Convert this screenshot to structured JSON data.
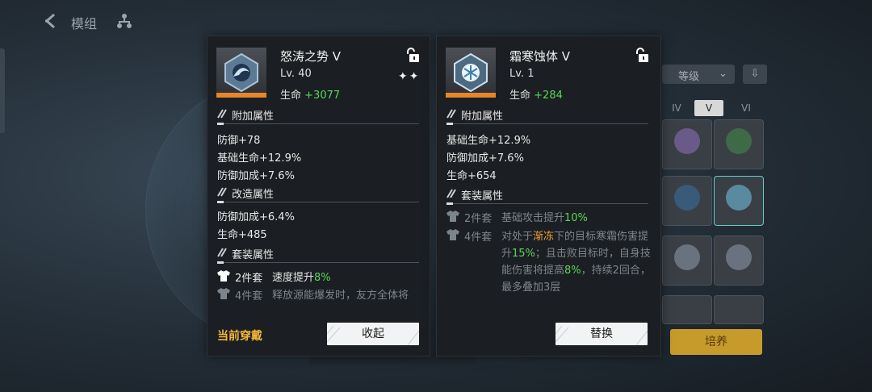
{
  "background": {
    "title": "模组",
    "sort_label": "等级",
    "tabs": [
      "IV",
      "V",
      "VI"
    ],
    "action_label": "培养"
  },
  "left_panel": {
    "name": "怒涛之势 V",
    "level": "Lv. 40",
    "main_stat_label": "生命",
    "main_stat_value": "+3077",
    "stars": "✦✦",
    "sections": {
      "extra_title": "附加属性",
      "extra_stats": [
        "防御+78",
        "基础生命+12.9%",
        "防御加成+7.6%"
      ],
      "mod_title": "改造属性",
      "mod_stats": [
        "防御加成+6.4%",
        "生命+485"
      ],
      "set_title": "套装属性",
      "set2_pieces": "2件套",
      "set2_text": "速度提升",
      "set2_value": "8%",
      "set4_pieces": "4件套",
      "set4_text": "释放源能爆发时，友方全体将"
    },
    "current_wear_label": "当前穿戴",
    "button_label": "收起"
  },
  "right_panel": {
    "name": "霜寒蚀体 V",
    "level": "Lv. 1",
    "main_stat_label": "生命",
    "main_stat_value": "+284",
    "sections": {
      "extra_title": "附加属性",
      "extra_stats": [
        "基础生命+12.9%",
        "防御加成+7.6%",
        "生命+654"
      ],
      "set_title": "套装属性",
      "set2_pieces": "2件套",
      "set2_text": "基础攻击提升",
      "set2_value": "10%",
      "set4_pieces": "4件套",
      "set4_a": "对处于",
      "set4_b": "渐冻",
      "set4_c": "下的目标寒霜伤害提升",
      "set4_d": "15%",
      "set4_e": "；且击败目标时，自身技能伤害将提高",
      "set4_f": "8%",
      "set4_g": "，持续2回合，最多叠加3层"
    },
    "button_label": "替换"
  },
  "colors": {
    "green": "#5cd65c",
    "orange": "#f2a036",
    "gold": "#f2b63a",
    "rarity_bar": "#e8852a"
  }
}
